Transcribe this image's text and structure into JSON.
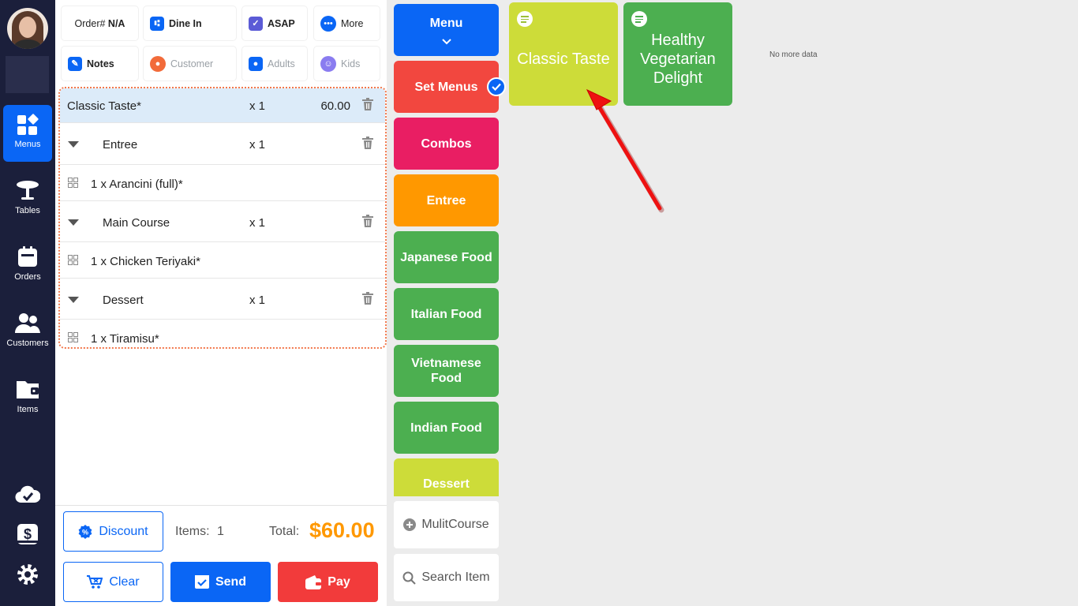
{
  "nav": {
    "items": [
      {
        "label": "Menus",
        "icon": "menus-icon",
        "active": true
      },
      {
        "label": "Tables",
        "icon": "table-icon"
      },
      {
        "label": "Orders",
        "icon": "orders-icon"
      },
      {
        "label": "Customers",
        "icon": "customers-icon"
      },
      {
        "label": "Items",
        "icon": "items-icon"
      }
    ],
    "bottom_icons": [
      "cloud-sync-icon",
      "cash-register-icon",
      "settings-icon"
    ]
  },
  "order": {
    "order_prefix": "Order#",
    "order_number": "N/A",
    "dine_label": "Dine In",
    "asap_label": "ASAP",
    "more_label": "More",
    "notes_label": "Notes",
    "customer_label": "Customer",
    "adults_label": "Adults",
    "kids_label": "Kids"
  },
  "lines": [
    {
      "name": "Classic Taste*",
      "qty": "x 1",
      "price": "60.00"
    },
    {
      "name": "Entree",
      "qty": "x 1"
    },
    {
      "name": "1 x Arancini (full)*"
    },
    {
      "name": "Main Course",
      "qty": "x 1"
    },
    {
      "name": "1 x Chicken Teriyaki*"
    },
    {
      "name": "Dessert",
      "qty": "x 1"
    },
    {
      "name": "1 x Tiramisu*"
    }
  ],
  "footer": {
    "discount_label": "Discount",
    "items_label": "Items:",
    "items_count": "1",
    "total_label": "Total:",
    "total_value": "$60.00",
    "clear_label": "Clear",
    "send_label": "Send",
    "pay_label": "Pay"
  },
  "categories": {
    "menu_label": "Menu",
    "items": [
      {
        "label": "Set Menus",
        "color": "#f2473f"
      },
      {
        "label": "Combos",
        "color": "#e91e63"
      },
      {
        "label": "Entree",
        "color": "#ff9800"
      },
      {
        "label": "Japanese Food",
        "color": "#4caf50"
      },
      {
        "label": "Italian Food",
        "color": "#4caf50"
      },
      {
        "label": "Vietnamese Food",
        "color": "#4caf50"
      },
      {
        "label": "Indian Food",
        "color": "#4caf50"
      },
      {
        "label": "Dessert",
        "color": "#cddc39"
      }
    ],
    "multicourse_label": "MulitCourse",
    "search_label": "Search Item"
  },
  "products": [
    {
      "label": "Classic Taste",
      "color": "#cddc39"
    },
    {
      "label": "Healthy Vegetarian Delight",
      "color": "#4caf50"
    }
  ],
  "no_more_data": "No more data",
  "colors": {
    "accent": "#0a66f5",
    "danger": "#f23b3b",
    "total": "#ff9800",
    "nav_bg": "#1b1f3b"
  }
}
